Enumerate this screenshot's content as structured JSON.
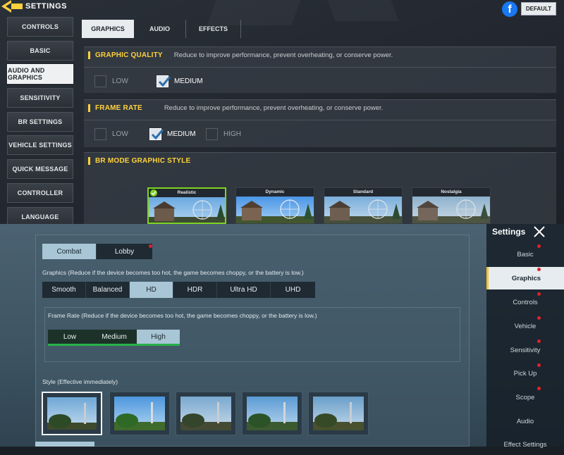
{
  "top": {
    "title": "SETTINGS",
    "default_label": "DEFAULT",
    "sidebar": [
      "CONTROLS",
      "BASIC",
      "AUDIO AND GRAPHICS",
      "SENSITIVITY",
      "BR SETTINGS",
      "VEHICLE SETTINGS",
      "QUICK MESSAGE",
      "CONTROLLER",
      "LANGUAGE"
    ],
    "tabs": [
      "GRAPHICS",
      "AUDIO",
      "EFFECTS"
    ],
    "graphic_quality": {
      "title": "GRAPHIC QUALITY",
      "desc": "Reduce to improve performance, prevent overheating, or conserve power.",
      "options": [
        "LOW",
        "MEDIUM"
      ],
      "selected": "MEDIUM"
    },
    "frame_rate": {
      "title": "FRAME RATE",
      "desc": "Reduce to improve performance, prevent overheating, or conserve power.",
      "options": [
        "LOW",
        "MEDIUM",
        "HIGH"
      ],
      "selected": "MEDIUM"
    },
    "br_style": {
      "title": "BR MODE GRAPHIC STYLE",
      "styles": [
        "Realistic",
        "Dynamic",
        "Standard",
        "Nostalgia"
      ],
      "selected": "Realistic"
    }
  },
  "bottom": {
    "mode_tabs": [
      "Combat",
      "Lobby"
    ],
    "graphics_label": "Graphics (Reduce if the device becomes too hot, the game becomes choppy, or the battery is low.)",
    "graphics_options": [
      "Smooth",
      "Balanced",
      "HD",
      "HDR",
      "Ultra HD",
      "UHD"
    ],
    "graphics_selected": "HD",
    "frame_rate_label": "Frame Rate (Reduce if the device becomes too hot, the game becomes choppy, or the battery is low.)",
    "frame_rate_options": [
      "Low",
      "Medium",
      "High"
    ],
    "frame_rate_selected": "High",
    "style_label": "Style (Effective immediately)",
    "sidebar_title": "Settings",
    "sidebar": [
      "Basic",
      "Graphics",
      "Controls",
      "Vehicle",
      "Sensitivity",
      "Pick Up",
      "Scope",
      "Audio",
      "Effect Settings"
    ],
    "sidebar_active": "Graphics"
  },
  "colors": {
    "cod_accent": "#ffd23c",
    "cod_selected_green": "#7ed321",
    "pubg_active": "#a8c6d6",
    "pubg_frame_green": "#28b14a",
    "notification_red": "#e0212b",
    "facebook_blue": "#1877f2"
  },
  "icons": {
    "back": "back-arrow-icon",
    "facebook": "facebook-icon",
    "check": "checkmark-icon",
    "close": "close-icon"
  }
}
